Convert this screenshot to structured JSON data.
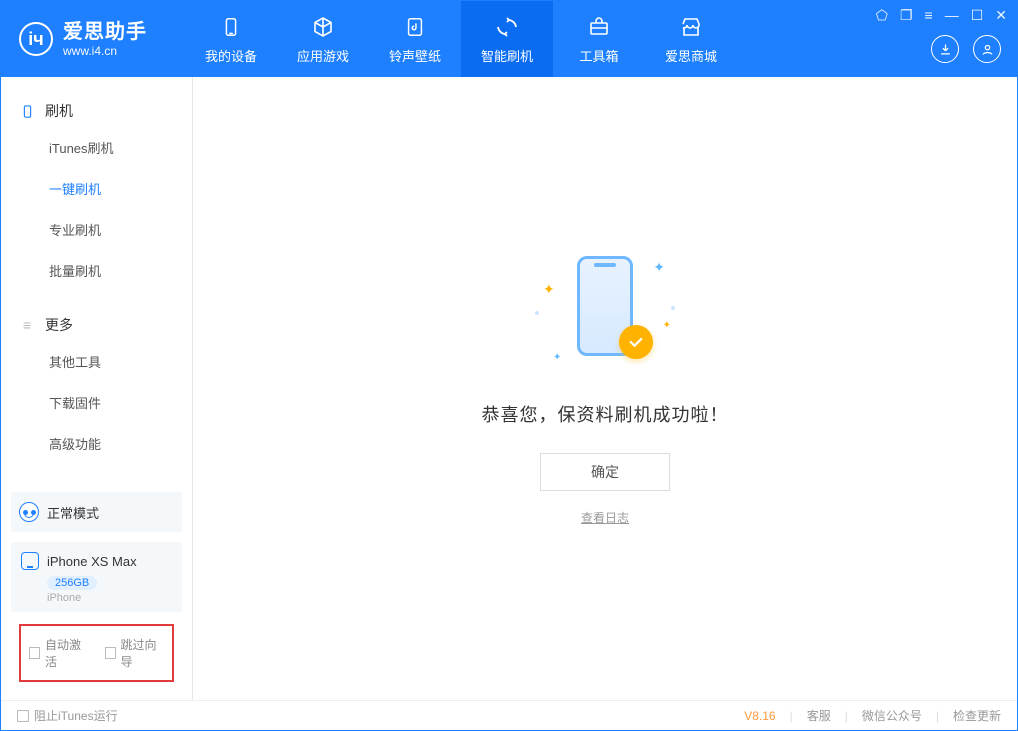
{
  "app": {
    "name": "爱思助手",
    "url": "www.i4.cn"
  },
  "nav": {
    "items": [
      {
        "label": "我的设备",
        "icon": "device"
      },
      {
        "label": "应用游戏",
        "icon": "cube"
      },
      {
        "label": "铃声壁纸",
        "icon": "music"
      },
      {
        "label": "智能刷机",
        "icon": "refresh"
      },
      {
        "label": "工具箱",
        "icon": "toolbox"
      },
      {
        "label": "爱思商城",
        "icon": "shop"
      }
    ],
    "active_index": 3
  },
  "sidebar": {
    "groups": [
      {
        "title": "刷机",
        "items": [
          "iTunes刷机",
          "一键刷机",
          "专业刷机",
          "批量刷机"
        ],
        "active_index": 1
      },
      {
        "title": "更多",
        "items": [
          "其他工具",
          "下载固件",
          "高级功能"
        ],
        "active_index": -1
      }
    ],
    "mode": {
      "label": "正常模式"
    },
    "device": {
      "name": "iPhone XS Max",
      "storage": "256GB",
      "type": "iPhone"
    },
    "checks": {
      "auto_activate": "自动激活",
      "skip_guide": "跳过向导"
    }
  },
  "main": {
    "message": "恭喜您，保资料刷机成功啦！",
    "ok_button": "确定",
    "view_log": "查看日志"
  },
  "footer": {
    "block_itunes": "阻止iTunes运行",
    "version": "V8.16",
    "links": [
      "客服",
      "微信公众号",
      "检查更新"
    ]
  }
}
